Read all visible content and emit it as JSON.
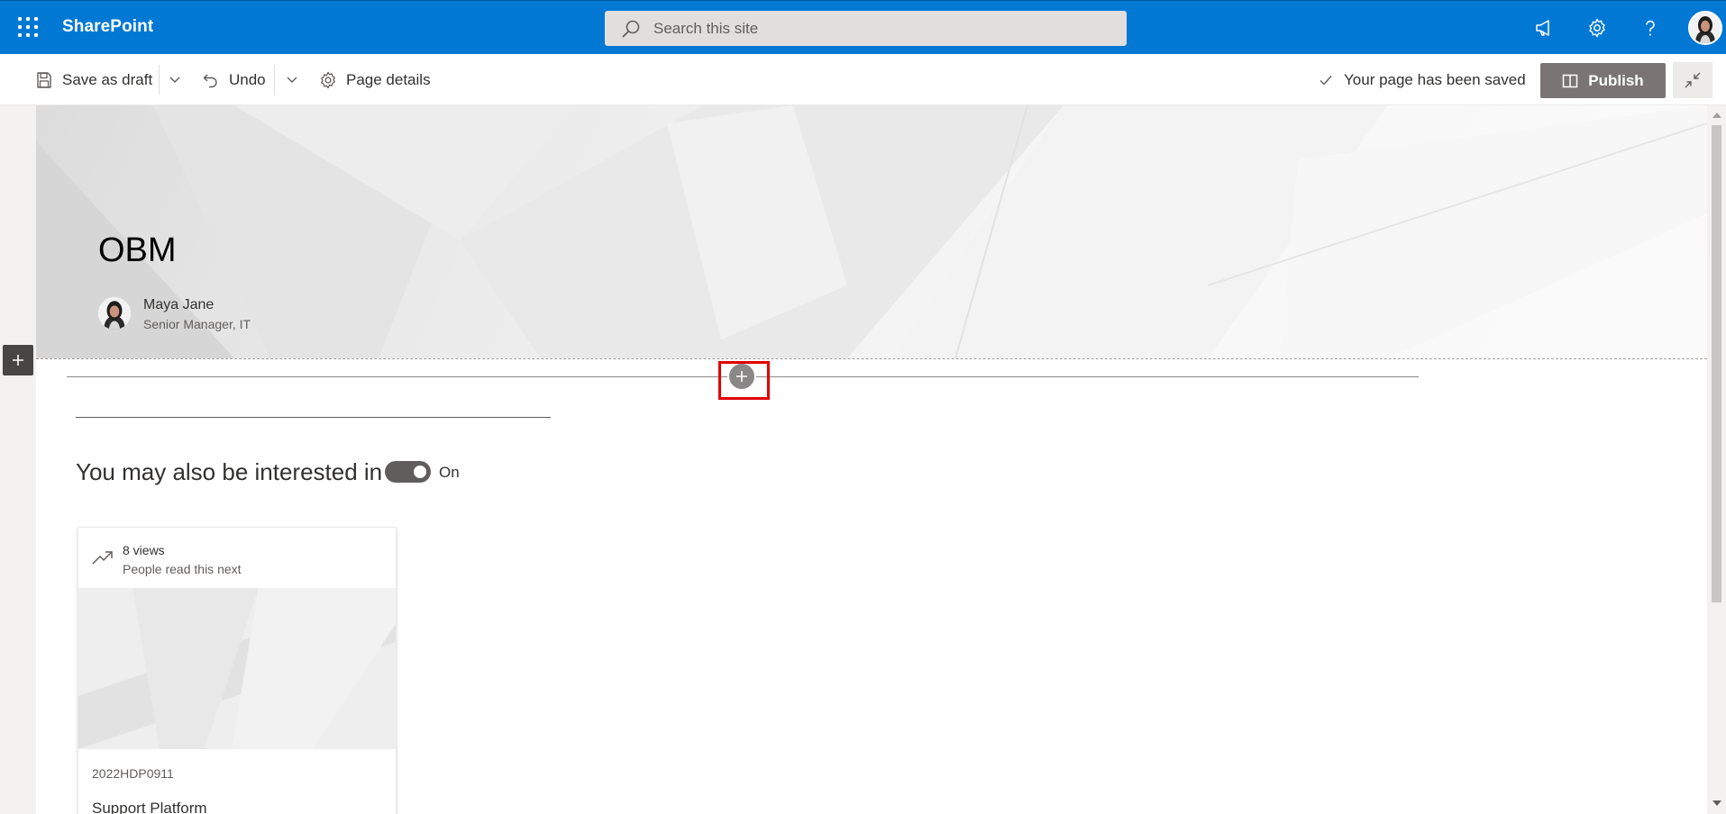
{
  "suite": {
    "app_name": "SharePoint",
    "search_placeholder": "Search this site",
    "icons": [
      "app-launcher-icon",
      "search-icon",
      "megaphone-icon",
      "gear-icon",
      "help-icon",
      "user-avatar"
    ]
  },
  "command_bar": {
    "save_draft_label": "Save as draft",
    "undo_label": "Undo",
    "page_details_label": "Page details",
    "saved_status": "Your page has been saved",
    "publish_label": "Publish"
  },
  "hero": {
    "title": "OBM",
    "author_name": "Maya Jane",
    "author_role": "Senior Manager, IT"
  },
  "recommendations": {
    "title": "You may also be interested in",
    "toggle_state": "On",
    "card": {
      "views": "8 views",
      "reason": "People read this next",
      "id": "2022HDP0911",
      "title": "Support Platform"
    }
  },
  "colors": {
    "suite_bar": "#0078d4",
    "publish_button": "#7a7574",
    "highlight_box": "#e00000"
  }
}
